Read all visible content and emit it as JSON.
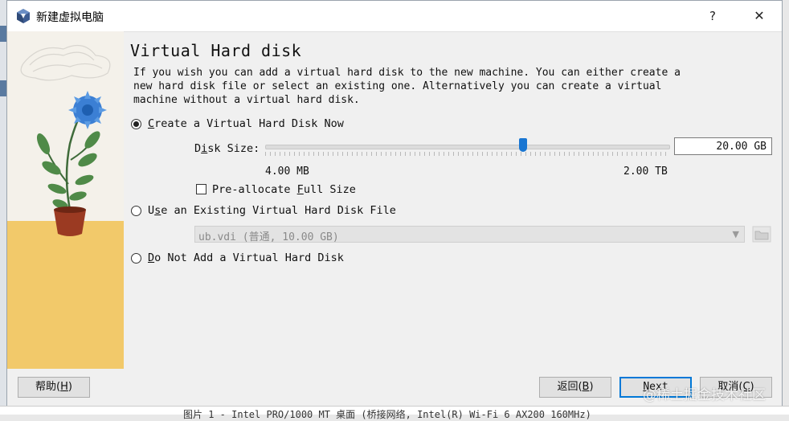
{
  "window": {
    "title": "新建虚拟电脑",
    "help": "?",
    "close": "✕"
  },
  "page": {
    "heading": "Virtual Hard disk",
    "description": "If you wish you can add a virtual hard disk to the new machine. You can either create a\nnew hard disk file or select an existing one. Alternatively you can create a virtual\nmachine without a virtual hard disk."
  },
  "options": {
    "create": {
      "label_pre": "",
      "label_mnemonic": "C",
      "label_post": "reate a Virtual Hard Disk Now",
      "selected": true
    },
    "existing": {
      "label_pre": "U",
      "label_mnemonic": "s",
      "label_post": "e an Existing Virtual Hard Disk File",
      "selected": false
    },
    "none": {
      "label_pre": "",
      "label_mnemonic": "D",
      "label_post": "o Not Add a Virtual Hard Disk",
      "selected": false
    }
  },
  "disk_size": {
    "label_pre": "D",
    "label_mnemonic": "i",
    "label_post": "sk Size:",
    "value": "20.00 GB",
    "min_label": "4.00 MB",
    "max_label": "2.00 TB",
    "slider_fraction": 0.64
  },
  "preallocate": {
    "label_pre": "Pre-allocate ",
    "label_mnemonic": "F",
    "label_post": "ull Size",
    "checked": false
  },
  "existing_file": {
    "selected": "ub.vdi (普通, 10.00 GB)"
  },
  "buttons": {
    "help": {
      "pre": "帮助(",
      "mn": "H",
      "post": ")"
    },
    "back": {
      "pre": "返回(",
      "mn": "B",
      "post": ")"
    },
    "next": {
      "pre": "",
      "mn": "N",
      "post": "ext"
    },
    "cancel": {
      "pre": "取消(",
      "mn": "C",
      "post": ")"
    }
  },
  "background": {
    "bottom_text": "图片 1 - Intel PRO/1000 MT 桌面 (桥接网络, Intel(R) Wi-Fi 6 AX200 160MHz)"
  },
  "watermark": "@稀土掘金技术社区",
  "colors": {
    "accent": "#1976d2",
    "art_floor": "#f2c96a",
    "flower": "#3b7fd4",
    "pot": "#9b3a22"
  }
}
